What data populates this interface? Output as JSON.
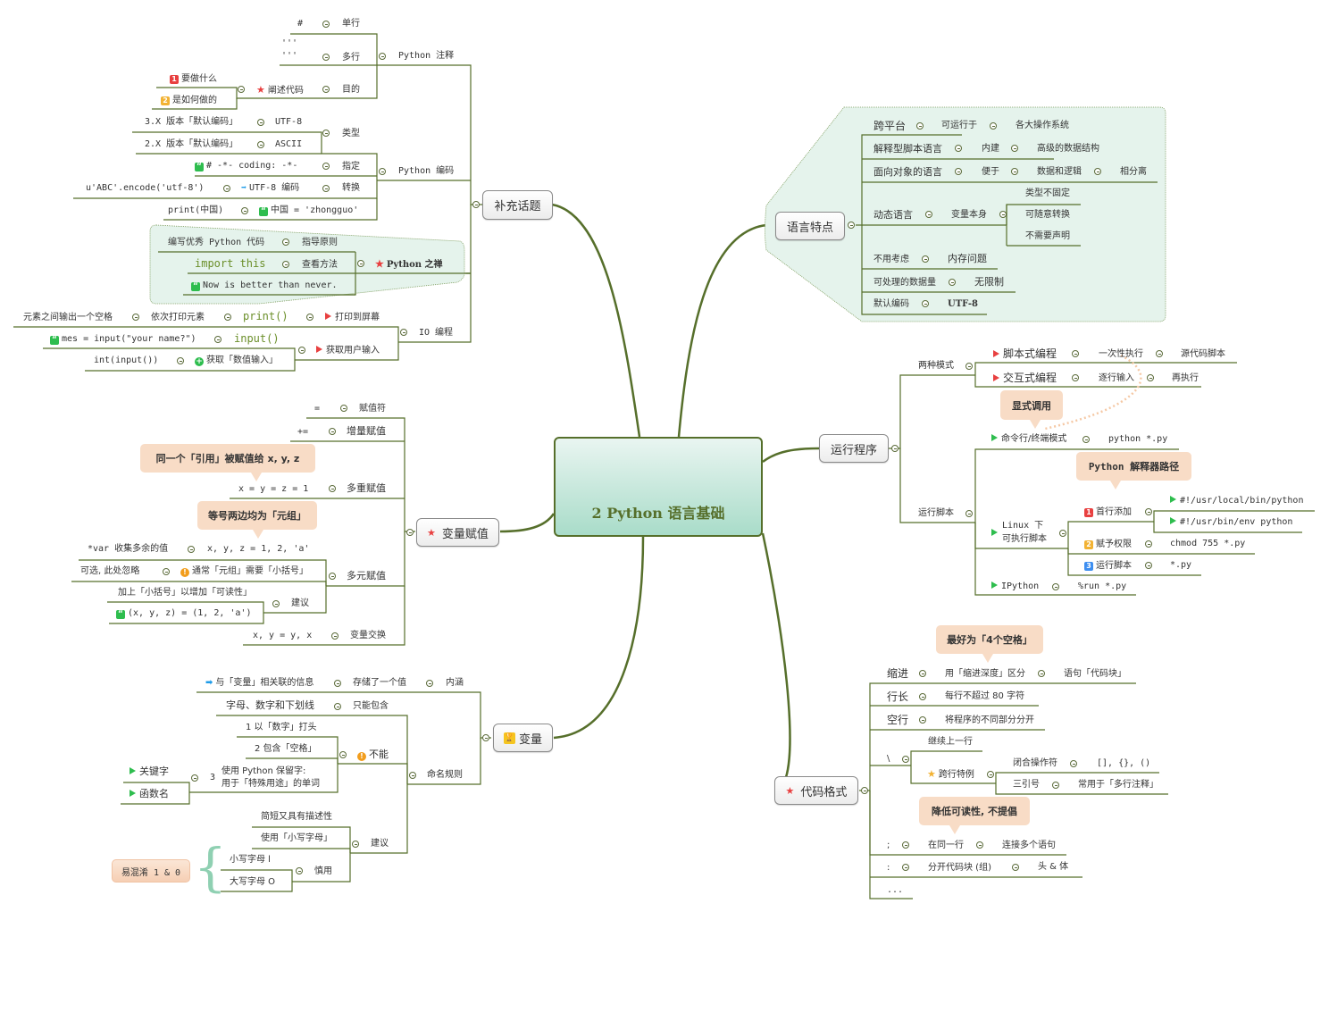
{
  "central": {
    "title": "2 Python 语言基础"
  },
  "colors": {
    "line": "#566f2b",
    "central_fill_top": "#e9f5f1",
    "central_fill_bottom": "#a9dcc9",
    "boundary_fill": "#e5f3ec",
    "callout_fill": "#f8dcc6",
    "flag_red": "#e84040",
    "flag_green": "#2ebd4e"
  },
  "supplement": {
    "label": "补充话题",
    "comments": {
      "label": "Python 注释",
      "single": {
        "label": "单行",
        "symbol": "#"
      },
      "multi": {
        "label": "多行",
        "symbol_top": "'''",
        "symbol_bottom": "'''"
      },
      "purpose": {
        "label": "目的",
        "child": "阐述代码",
        "items": [
          "要做什么",
          "是如何做的"
        ]
      }
    },
    "encoding": {
      "label": "Python 编码",
      "type": {
        "label": "类型",
        "items": [
          {
            "value": "UTF-8",
            "desc": "3.X 版本「默认编码」"
          },
          {
            "value": "ASCII",
            "desc": "2.X 版本「默认编码」"
          }
        ]
      },
      "specify": {
        "label": "指定",
        "value": "# -*- coding:  -*-"
      },
      "convert": {
        "label": "转换",
        "value": "UTF-8 编码",
        "example": "u'ABC'.encode('utf-8')"
      },
      "extra": {
        "value": "中国 = 'zhongguo'",
        "example": "print(中国)"
      }
    },
    "zen": {
      "label": "Python 之禅",
      "principle": {
        "label": "指导原则",
        "value": "编写优秀 Python 代码"
      },
      "view": {
        "label": "查看方法",
        "value": "import this"
      },
      "quote": "Now is better than never."
    },
    "io": {
      "label": "IO 编程",
      "print": {
        "label": "打印到屏幕",
        "func": "print()",
        "behavior": "依次打印元素",
        "detail": "元素之间输出一个空格"
      },
      "input": {
        "label": "获取用户输入",
        "func": "input()",
        "example": "mes = input(\"your name?\")",
        "numeric": "获取「数值输入」",
        "numeric_example": "int(input())"
      }
    }
  },
  "assign": {
    "label": "变量赋值",
    "rows": [
      {
        "label": "赋值符",
        "value": "="
      },
      {
        "label": "增量赋值",
        "value": "+="
      },
      {
        "label": "多重赋值",
        "value": "x = y = z = 1",
        "note": "同一个「引用」被赋值给 x, y, z"
      },
      {
        "label": "多元赋值",
        "value": "x, y, z = 1, 2, 'a'",
        "note": "等号两边均为「元组」",
        "extra": "*var 收集多余的值",
        "warn": "通常「元组」需要「小括号」",
        "warn_detail": "可选, 此处忽略",
        "suggest_label": "建议",
        "suggest": "加上「小括号」以增加「可读性」",
        "suggest_example": "(x, y, z) = (1, 2, 'a')"
      },
      {
        "label": "变量交换",
        "value": "x, y = y, x"
      }
    ]
  },
  "variable": {
    "label": "变量",
    "meaning": {
      "label": "内涵",
      "child": "存储了一个值",
      "detail": "与「变量」相关联的信息"
    },
    "naming": {
      "label": "命名规则",
      "only": {
        "label": "只能包含",
        "value": "字母、数字和下划线"
      },
      "cannot": {
        "label": "不能",
        "items": [
          "1 以「数字」打头",
          "2 包含「空格」"
        ],
        "item3_num": "3",
        "item3_line1": "使用 Python 保留字:",
        "item3_line2": "用于「特殊用途」的单词",
        "item3_children": [
          "关键字",
          "函数名"
        ]
      },
      "suggest": {
        "label": "建议",
        "items": [
          "简短又具有描述性",
          "使用「小写字母」"
        ],
        "careful": {
          "label": "慎用",
          "items": [
            "小写字母 l",
            "大写字母 O"
          ],
          "note": "易混淆 1 & 0"
        }
      }
    }
  },
  "features": {
    "label": "语言特点",
    "rows": [
      {
        "a": "跨平台",
        "b": "可运行于",
        "c": "各大操作系统"
      },
      {
        "a": "解释型脚本语言",
        "b": "内建",
        "c": "高级的数据结构"
      },
      {
        "a": "面向对象的语言",
        "b": "便于",
        "c": "数据和逻辑",
        "d": "相分离"
      },
      {
        "a": "动态语言",
        "b": "变量本身",
        "children": [
          "类型不固定",
          "可随意转换",
          "不需要声明"
        ]
      },
      {
        "a": "不用考虑",
        "b": "内存问题"
      },
      {
        "a": "可处理的数据量",
        "b": "无限制"
      },
      {
        "a": "默认编码",
        "b": "UTF-8"
      }
    ]
  },
  "run": {
    "label": "运行程序",
    "modes": {
      "label": "两种模式",
      "script": {
        "label": "脚本式编程",
        "b": "一次性执行",
        "c": "源代码脚本"
      },
      "interactive": {
        "label": "交互式编程",
        "b": "逐行输入",
        "c": "再执行"
      }
    },
    "explicit_note": "显式调用",
    "scripts": {
      "label": "运行脚本",
      "cmd": {
        "label": "命令行/终端模式",
        "value": "python *.py"
      },
      "linux": {
        "label_line1": "Linux 下",
        "label_line2": "可执行脚本",
        "interp_note": "Python 解释器路径",
        "steps": [
          {
            "num": "1",
            "label": "首行添加",
            "values": [
              "#!/usr/local/bin/python",
              "#!/usr/bin/env python"
            ]
          },
          {
            "num": "2",
            "label": "赋予权限",
            "value": "chmod 755 *.py"
          },
          {
            "num": "3",
            "label": "运行脚本",
            "value": "*.py"
          }
        ]
      },
      "ipython": {
        "label": "IPython",
        "value": "%run *.py"
      }
    }
  },
  "format": {
    "label": "代码格式",
    "indent": {
      "label": "缩进",
      "b": "用「缩进深度」区分",
      "c": "语句「代码块」",
      "note": "最好为「4个空格」"
    },
    "line_len": {
      "label": "行长",
      "b": "每行不超过 80 字符"
    },
    "blank": {
      "label": "空行",
      "b": "将程序的不同部分分开"
    },
    "backslash": {
      "label": "\\",
      "cont": "继续上一行",
      "special": "跨行特例",
      "close": {
        "label": "闭合操作符",
        "value": "[], {}, ()"
      },
      "triple": {
        "label": "三引号",
        "value": "常用于「多行注释」"
      }
    },
    "semicolon": {
      "label": ";",
      "b": "在同一行",
      "c": "连接多个语句",
      "note": "降低可读性, 不提倡"
    },
    "colon": {
      "label": ":",
      "b": "分开代码块 (组)",
      "c": "头 & 体"
    },
    "more": "..."
  }
}
